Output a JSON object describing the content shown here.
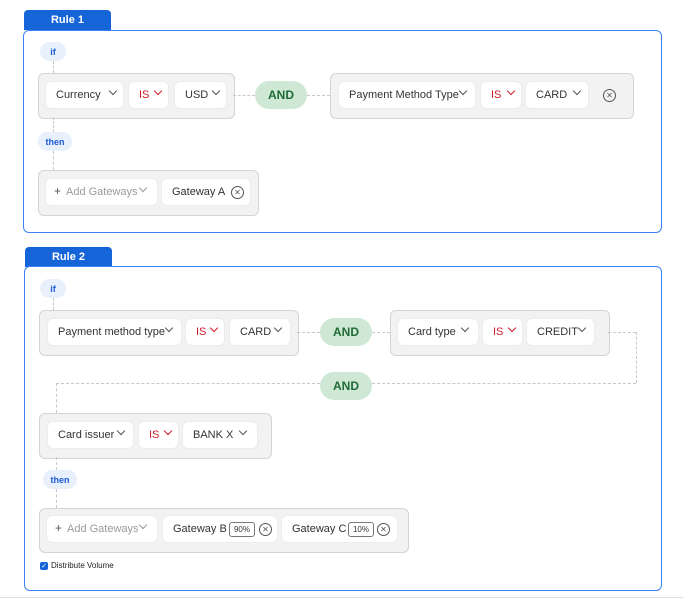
{
  "rules": [
    {
      "title": "Rule 1",
      "if_label": "if",
      "then_label": "then",
      "and_labels": [
        "AND"
      ],
      "conditions": [
        {
          "field": "Currency",
          "op": "IS",
          "value": "USD"
        },
        {
          "field": "Payment Method Type",
          "op": "IS",
          "value": "CARD"
        }
      ],
      "add_gateways_placeholder": "Add Gateways",
      "gateways": [
        {
          "name": "Gateway A"
        }
      ]
    },
    {
      "title": "Rule 2",
      "if_label": "if",
      "then_label": "then",
      "and_labels": [
        "AND",
        "AND"
      ],
      "conditions": [
        {
          "field": "Payment method type",
          "op": "IS",
          "value": "CARD"
        },
        {
          "field": "Card type",
          "op": "IS",
          "value": "CREDIT"
        },
        {
          "field": "Card issuer",
          "op": "IS",
          "value": "BANK X"
        }
      ],
      "add_gateways_placeholder": "Add Gateways",
      "gateways": [
        {
          "name": "Gateway B",
          "percent": "90%"
        },
        {
          "name": "Gateway C",
          "percent": "10%"
        }
      ],
      "distribute_volume": {
        "label": "Distribute Volume",
        "checked": true
      }
    }
  ],
  "colors": {
    "accent": "#1565d8",
    "and_bg": "#cfe8d5",
    "and_text": "#1e6b35",
    "operator": "#d11a2a"
  },
  "icons": {
    "chevron": "chevron-down-icon",
    "remove": "remove-circle-x-icon",
    "add": "plus-icon",
    "check": "checkbox-checked-icon"
  }
}
